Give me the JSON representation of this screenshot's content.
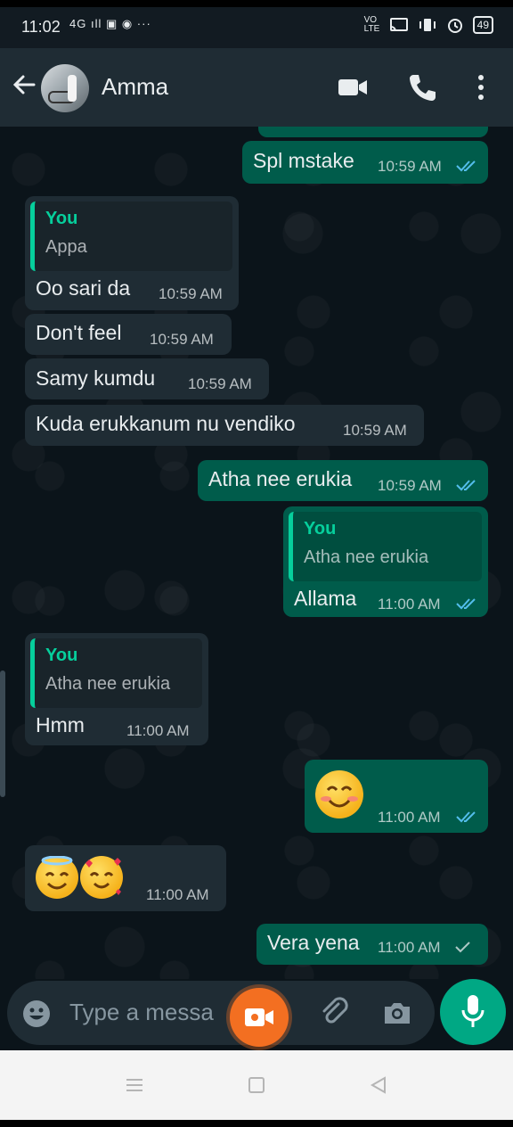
{
  "status": {
    "time": "11:02",
    "left_icons": "4G ıll ▣ ◉ ···",
    "volte": "VO LTE",
    "battery": "49"
  },
  "header": {
    "title": "Amma"
  },
  "messages": [
    {
      "id": "m1",
      "dir": "out",
      "text": "Spl mstake",
      "time": "10:59 AM",
      "status": "read"
    },
    {
      "id": "m2",
      "dir": "in",
      "quote_name": "You",
      "quote_text": "Appa",
      "text": "Oo sari da",
      "time": "10:59 AM"
    },
    {
      "id": "m3",
      "dir": "in",
      "text": "Don't feel",
      "time": "10:59 AM"
    },
    {
      "id": "m4",
      "dir": "in",
      "text": "Samy kumdu",
      "time": "10:59 AM"
    },
    {
      "id": "m5",
      "dir": "in",
      "text": "Kuda erukkanum nu vendiko",
      "time": "10:59 AM"
    },
    {
      "id": "m6",
      "dir": "out",
      "text": "Atha nee erukia",
      "time": "10:59 AM",
      "status": "read"
    },
    {
      "id": "m7",
      "dir": "out",
      "quote_name": "You",
      "quote_text": "Atha nee erukia",
      "text": "Allama",
      "time": "11:00 AM",
      "status": "read"
    },
    {
      "id": "m8",
      "dir": "in",
      "quote_name": "You",
      "quote_text": "Atha nee erukia",
      "text": "Hmm",
      "time": "11:00 AM"
    },
    {
      "id": "m9",
      "dir": "out",
      "emoji": "smiling-face-with-smiling-eyes",
      "time": "11:00 AM",
      "status": "read"
    },
    {
      "id": "m10",
      "dir": "in",
      "emoji": "halo-and-hearts",
      "time": "11:00 AM"
    },
    {
      "id": "m11",
      "dir": "out",
      "text": "Vera yena",
      "time": "11:00 AM",
      "status": "sent"
    }
  ],
  "composer": {
    "placeholder": "Type a messa"
  },
  "colors": {
    "header_bg": "#1f2c34",
    "chat_bg": "#0b141a",
    "out_bubble": "#005c4b",
    "in_bubble": "#1f2c34",
    "accent": "#00a884",
    "read_tick": "#53bdeb"
  }
}
